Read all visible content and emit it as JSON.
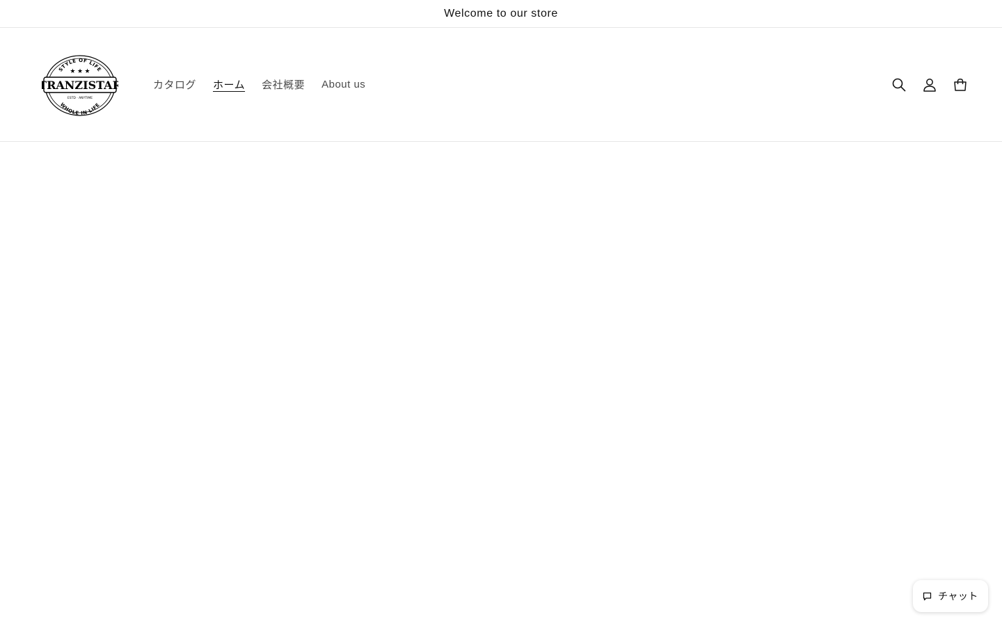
{
  "announcement": {
    "text": "Welcome to our store"
  },
  "logo": {
    "brand": "TRANZISTAR",
    "top_text": "STYLE OF LIFE",
    "bottom_text": "WHOLE IN LIFE",
    "estd_text": "ESTD · ANYTIME"
  },
  "nav": {
    "items": [
      {
        "label": "カタログ",
        "active": false
      },
      {
        "label": "ホーム",
        "active": true
      },
      {
        "label": "会社概要",
        "active": false
      },
      {
        "label": "About us",
        "active": false
      }
    ]
  },
  "header_icons": {
    "search": "search-icon",
    "account": "account-icon",
    "cart": "cart-icon"
  },
  "chat": {
    "label": "チャット",
    "icon": "chat-bubble-icon"
  },
  "colors": {
    "text": "#121212",
    "nav_text": "#4a4a4a",
    "border": "#e6e6e6",
    "background": "#ffffff"
  }
}
